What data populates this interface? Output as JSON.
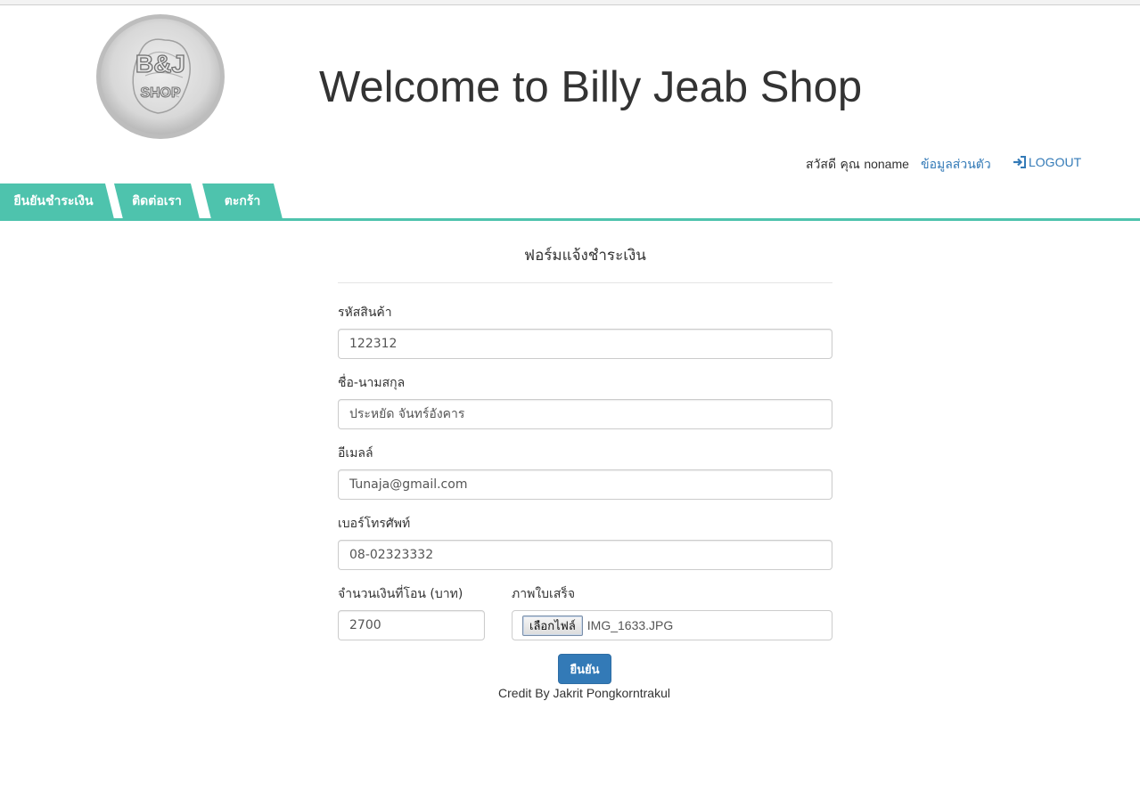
{
  "header": {
    "logo_text_top": "B&J",
    "logo_text_bottom": "SHOP",
    "title": "Welcome to Billy Jeab Shop"
  },
  "userbar": {
    "greeting": "สวัสดี คุณ",
    "username": "noname",
    "profile_link": "ข้อมูลส่วนตัว",
    "logout_link": "LOGOUT",
    "logout_icon": "sign-in-icon"
  },
  "tabs": [
    {
      "label": "ยืนยันชำระเงิน"
    },
    {
      "label": "ติดต่อเรา"
    },
    {
      "label": "ตะกร้า"
    }
  ],
  "form": {
    "title": "ฟอร์มแจ้งชำระเงิน",
    "product_code": {
      "label": "รหัสสินค้า",
      "value": "122312"
    },
    "full_name": {
      "label": "ชื่อ-นามสกุล",
      "value": "ประหยัด จันทร์อังคาร"
    },
    "email": {
      "label": "อีเมลล์",
      "value": "Tunaja@gmail.com"
    },
    "phone": {
      "label": "เบอร์โทรศัพท์",
      "value": "08-02323332"
    },
    "amount": {
      "label": "จำนวนเงินที่โอน (บาท)",
      "value": "2700"
    },
    "receipt": {
      "label": "ภาพใบเสร็จ",
      "button": "เลือกไฟล์",
      "file_name": "IMG_1633.JPG"
    },
    "submit_label": "ยืนยัน"
  },
  "footer": {
    "credit": "Credit By Jakrit Pongkorntrakul"
  },
  "colors": {
    "tab_teal": "#4ec3ad",
    "link_blue": "#337ab7",
    "button_blue": "#337ab7"
  }
}
